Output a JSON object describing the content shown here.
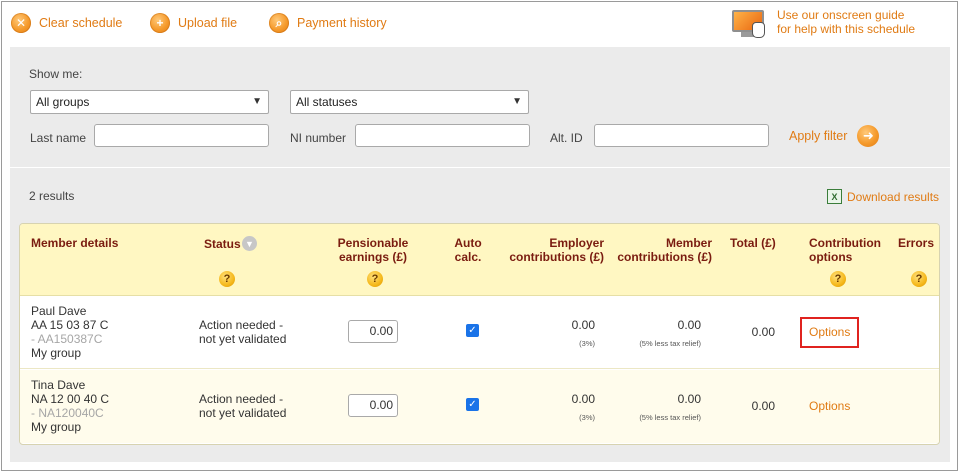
{
  "toolbar": {
    "clear_label": "Clear schedule",
    "upload_label": "Upload file",
    "history_label": "Payment history",
    "guide_line1": "Use our onscreen guide",
    "guide_line2": "for help with this schedule"
  },
  "filter": {
    "show_me_label": "Show me:",
    "group_select": "All groups",
    "status_select": "All statuses",
    "last_name_label": "Last name",
    "last_name_value": "",
    "ni_label": "NI number",
    "ni_value": "",
    "alt_id_label": "Alt. ID",
    "alt_id_value": "",
    "apply_label": "Apply filter"
  },
  "results": {
    "count": "2 results",
    "download_label": "Download results"
  },
  "table": {
    "headers": {
      "member": "Member details",
      "status": "Status",
      "earn1": "Pensionable",
      "earn2": "earnings (£)",
      "auto1": "Auto",
      "auto2": "calc.",
      "emp1": "Employer",
      "emp2": "contributions (£)",
      "mem1": "Member",
      "mem2": "contributions (£)",
      "total": "Total (£)",
      "opt1": "Contribution",
      "opt2": "options",
      "errors": "Errors"
    },
    "rows": [
      {
        "name": "Paul Dave",
        "ni": "AA 15 03 87 C",
        "alt": "- AA150387C",
        "group": "My group",
        "status1": "Action needed -",
        "status2": "not yet validated",
        "earnings": "0.00",
        "auto_calc": true,
        "employer": "0.00",
        "employer_note": "(3%)",
        "member": "0.00",
        "member_note": "(5% less tax relief)",
        "total": "0.00",
        "options": "Options"
      },
      {
        "name": "Tina Dave",
        "ni": "NA 12 00 40 C",
        "alt": "- NA120040C",
        "group": "My group",
        "status1": "Action needed -",
        "status2": "not yet validated",
        "earnings": "0.00",
        "auto_calc": true,
        "employer": "0.00",
        "employer_note": "(3%)",
        "member": "0.00",
        "member_note": "(5% less tax relief)",
        "total": "0.00",
        "options": "Options"
      }
    ]
  },
  "colors": {
    "accent": "#e07b14",
    "header_bg": "#fff7c2",
    "header_text": "#7a1c10",
    "highlight": "#e0231f"
  },
  "icons": [
    "clear-icon",
    "upload-icon",
    "search-history-icon",
    "monitor-guide-icon",
    "arrow-right-icon",
    "excel-icon",
    "help-icon",
    "sort-icon",
    "checkbox-icon",
    "chevron-down-icon"
  ]
}
